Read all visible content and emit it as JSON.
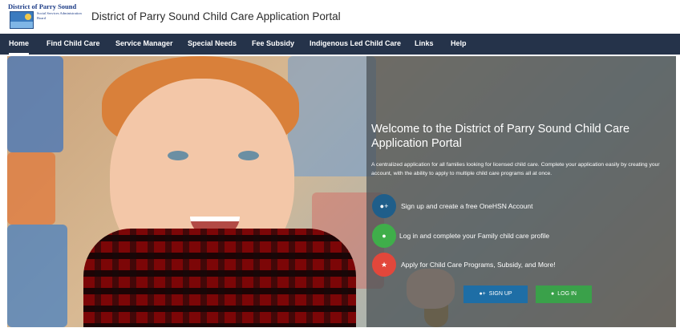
{
  "header": {
    "logo_top": "District of Parry Sound",
    "logo_sub": "Social Services Administration Board",
    "title": "District of Parry Sound Child Care Application Portal"
  },
  "nav": {
    "items": [
      {
        "label": "Home"
      },
      {
        "label": "Find Child Care"
      },
      {
        "label": "Service Manager"
      },
      {
        "label": "Special Needs"
      },
      {
        "label": "Fee Subsidy"
      },
      {
        "label": "Indigenous Led Child Care"
      },
      {
        "label": "Links"
      },
      {
        "label": "Help"
      }
    ]
  },
  "hero": {
    "welcome": "Welcome to the District of Parry Sound Child Care Application Portal",
    "description": "A centralized application for all families looking for licensed child care. Complete your application easily by creating your account, with the ability to apply to multiple child care programs all at once.",
    "steps": [
      {
        "text": "Sign up and create a free OneHSN Account",
        "icon": "user-plus-icon",
        "color": "#1f5e8a"
      },
      {
        "text": "Log in and complete your Family child care profile",
        "icon": "user-icon",
        "color": "#3fae4a"
      },
      {
        "text": "Apply for Child Care Programs, Subsidy, and More!",
        "icon": "star-icon",
        "color": "#e2473b"
      }
    ],
    "buttons": {
      "signup": "SIGN UP",
      "login": "LOG IN"
    }
  },
  "colors": {
    "nav_bg": "#25334a",
    "signup": "#1e6ea6",
    "login": "#3aa14a"
  }
}
